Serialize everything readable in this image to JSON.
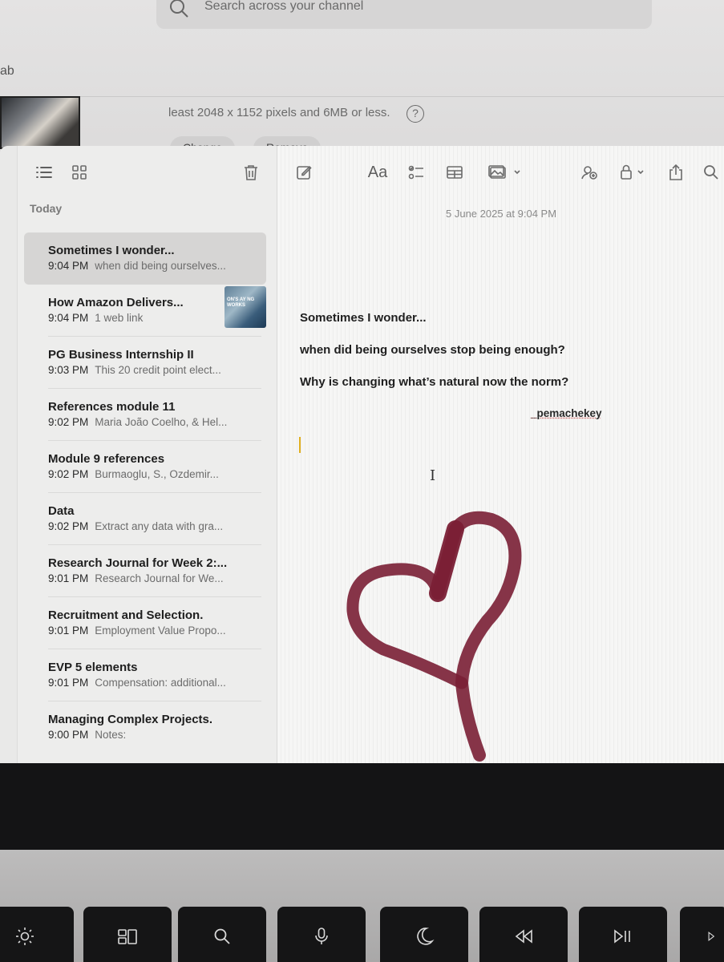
{
  "background_page": {
    "search_placeholder": "Search across your channel",
    "tab_label": "ab",
    "image_hint": "least 2048 x 1152 pixels and 6MB or less.",
    "help_glyph": "?",
    "buttons": [
      "Change",
      "Remove"
    ]
  },
  "toolbar": {
    "list_view": "list-view-icon",
    "gallery_view": "gallery-view-icon",
    "delete": "trash-icon",
    "compose": "compose-icon",
    "format_label": "Aa",
    "checklist": "checklist-icon",
    "table": "table-icon",
    "media": "media-icon",
    "collaborate": "collaborate-icon",
    "lock": "lock-icon",
    "share": "share-icon",
    "search": "search-icon"
  },
  "sidebar": {
    "section_header": "Today",
    "notes": [
      {
        "title": "Sometimes I wonder...",
        "time": "9:04 PM",
        "preview": "when did being ourselves..."
      },
      {
        "title": "How Amazon Delivers...",
        "time": "9:04 PM",
        "preview": "1 web link",
        "thumbnail_text": "ON'S AY NG WORKS"
      },
      {
        "title": "PG Business Internship II",
        "time": "9:03 PM",
        "preview": "This 20 credit point elect..."
      },
      {
        "title": "References module 11",
        "time": "9:02 PM",
        "preview": "Maria João Coelho, & Hel..."
      },
      {
        "title": "Module 9 references",
        "time": "9:02 PM",
        "preview": "Burmaoglu, S., Ozdemir..."
      },
      {
        "title": "Data",
        "time": "9:02 PM",
        "preview": "Extract any data with gra..."
      },
      {
        "title": "Research Journal for Week 2:...",
        "time": "9:01 PM",
        "preview": "Research Journal for We..."
      },
      {
        "title": "Recruitment and Selection.",
        "time": "9:01 PM",
        "preview": "Employment Value Propo..."
      },
      {
        "title": "EVP 5 elements",
        "time": "9:01 PM",
        "preview": "Compensation: additional..."
      },
      {
        "title": "Managing Complex Projects.",
        "time": "9:00 PM",
        "preview": "Notes:"
      }
    ]
  },
  "editor": {
    "date": "5 June 2025 at 9:04 PM",
    "line1": "Sometimes I wonder...",
    "line2": "when did being ourselves stop being enough?",
    "line3": "Why is changing what’s natural now the norm?",
    "signature": "_pemachekey",
    "drawing": "heart-drawing",
    "drawing_color": "#7a1f35"
  },
  "touch_bar_keys": [
    "brightness-icon",
    "mission-control-icon",
    "spotlight-icon",
    "dictation-icon",
    "do-not-disturb-icon",
    "rewind-icon",
    "play-pause-icon",
    "fast-forward-icon"
  ]
}
